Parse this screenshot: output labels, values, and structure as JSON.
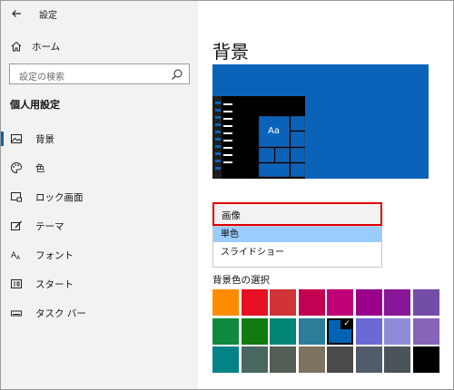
{
  "app": {
    "title": "設定"
  },
  "sidebar": {
    "home_label": "ホーム",
    "search_placeholder": "設定の検索",
    "section_title": "個人用設定",
    "items": [
      {
        "label": "背景",
        "icon": "picture-icon",
        "active": true
      },
      {
        "label": "色",
        "icon": "palette-icon"
      },
      {
        "label": "ロック画面",
        "icon": "lock-screen-icon"
      },
      {
        "label": "テーマ",
        "icon": "theme-brush-icon"
      },
      {
        "label": "フォント",
        "icon": "font-icon"
      },
      {
        "label": "スタート",
        "icon": "start-icon"
      },
      {
        "label": "タスク バー",
        "icon": "taskbar-icon"
      }
    ]
  },
  "main": {
    "title": "背景",
    "preview_sample_text": "Aa",
    "background_dropdown": {
      "selected": "画像",
      "options": [
        "単色",
        "スライドショー"
      ],
      "highlighted_option": "単色"
    },
    "color_section_label": "背景色の選択",
    "colors": [
      [
        "#ff8c00",
        "#e81123",
        "#d13438",
        "#c30052",
        "#bf0077",
        "#9a0089",
        "#881798",
        "#744da9"
      ],
      [
        "#10893e",
        "#107c10",
        "#018574",
        "#2d7d9a",
        "#0063b1",
        "#6b69d6",
        "#8e8cd8",
        "#8764b8"
      ],
      [
        "#038387",
        "#486860",
        "#525e54",
        "#7e735f",
        "#4c4a48",
        "#515c6b",
        "#4a5459",
        "#000000"
      ]
    ],
    "selected_color": "#0063b1"
  }
}
